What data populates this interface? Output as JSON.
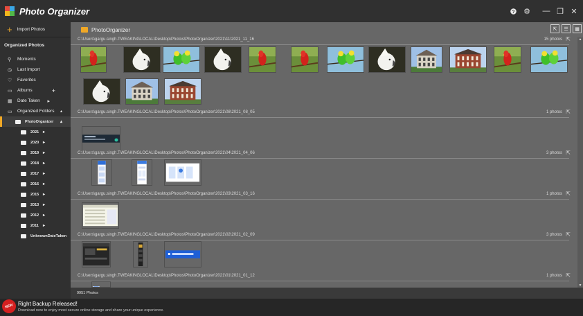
{
  "app": {
    "title": "Photo Organizer",
    "accent": "#f0a826"
  },
  "window_controls": [
    "help-icon",
    "settings-icon",
    "minimize-icon",
    "restore-icon",
    "close-icon"
  ],
  "sidebar": {
    "import_label": "Import Photos",
    "section_title": "Organized Photos",
    "nav": {
      "moments": "Moments",
      "last_import": "Last Import",
      "favorites": "Favorites",
      "albums": "Albums",
      "date_taken": "Date Taken",
      "organized_folders": "Organized Folders",
      "photo_organizer": "PhotoOrganizer"
    },
    "years": [
      "2021",
      "2020",
      "2019",
      "2018",
      "2017",
      "2016",
      "2015",
      "2013",
      "2012",
      "2011",
      "UnknownDateTaken"
    ]
  },
  "main": {
    "folder_title": "PhotoOrganizer",
    "groups": [
      {
        "path": "C:\\Users\\gargu.singh.TWEAKINGLOCAL\\Desktop\\Photos\\PhotoOrganizer\\2021\\11\\2021_11_16",
        "count": "15 photos"
      },
      {
        "path": "C:\\Users\\gargu.singh.TWEAKINGLOCAL\\Desktop\\Photos\\PhotoOrganizer\\2021\\08\\2021_08_05",
        "count": "1 photos"
      },
      {
        "path": "C:\\Users\\gargu.singh.TWEAKINGLOCAL\\Desktop\\Photos\\PhotoOrganizer\\2021\\04\\2021_04_06",
        "count": "3 photos"
      },
      {
        "path": "C:\\Users\\gargu.singh.TWEAKINGLOCAL\\Desktop\\Photos\\PhotoOrganizer\\2021\\03\\2021_03_16",
        "count": "1 photos"
      },
      {
        "path": "C:\\Users\\gargu.singh.TWEAKINGLOCAL\\Desktop\\Photos\\PhotoOrganizer\\2021\\02\\2021_02_09",
        "count": "3 photos"
      },
      {
        "path": "C:\\Users\\gargu.singh.TWEAKINGLOCAL\\Desktop\\Photos\\PhotoOrganizer\\2021\\01\\2021_01_12",
        "count": "1 photos"
      }
    ],
    "footer_count": "9951 Photos"
  },
  "banner": {
    "badge": "NEW",
    "title": "Right Backup Released!",
    "text": "Download now to enjoy most secure online storage and share your unique experience."
  }
}
